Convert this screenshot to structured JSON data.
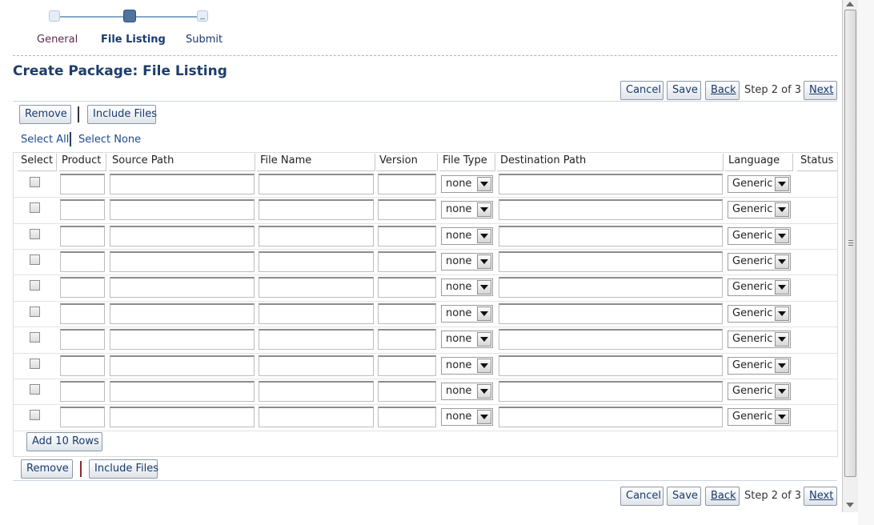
{
  "train": {
    "steps": [
      {
        "label": "General",
        "state": "visited"
      },
      {
        "label": "File Listing",
        "state": "current"
      },
      {
        "label": "Submit",
        "state": "unvisited"
      }
    ]
  },
  "page": {
    "title": "Create Package: File Listing"
  },
  "nav": {
    "cancel": "Cancel",
    "save": "Save",
    "back": "Back",
    "step_text": "Step 2 of 3",
    "next": "Next"
  },
  "actions": {
    "remove": "Remove",
    "include_files": "Include Files",
    "select_all": "Select All",
    "select_none": "Select None",
    "add_rows": "Add 10 Rows"
  },
  "table": {
    "columns": [
      "Select",
      "Product",
      "Source Path",
      "File Name",
      "Version",
      "File Type",
      "Destination Path",
      "Language",
      "Status"
    ],
    "rows": [
      {
        "product": "",
        "source_path": "",
        "file_name": "",
        "version": "",
        "file_type": "none",
        "destination_path": "",
        "language": "Generic",
        "status": ""
      },
      {
        "product": "",
        "source_path": "",
        "file_name": "",
        "version": "",
        "file_type": "none",
        "destination_path": "",
        "language": "Generic",
        "status": ""
      },
      {
        "product": "",
        "source_path": "",
        "file_name": "",
        "version": "",
        "file_type": "none",
        "destination_path": "",
        "language": "Generic",
        "status": ""
      },
      {
        "product": "",
        "source_path": "",
        "file_name": "",
        "version": "",
        "file_type": "none",
        "destination_path": "",
        "language": "Generic",
        "status": ""
      },
      {
        "product": "",
        "source_path": "",
        "file_name": "",
        "version": "",
        "file_type": "none",
        "destination_path": "",
        "language": "Generic",
        "status": ""
      },
      {
        "product": "",
        "source_path": "",
        "file_name": "",
        "version": "",
        "file_type": "none",
        "destination_path": "",
        "language": "Generic",
        "status": ""
      },
      {
        "product": "",
        "source_path": "",
        "file_name": "",
        "version": "",
        "file_type": "none",
        "destination_path": "",
        "language": "Generic",
        "status": ""
      },
      {
        "product": "",
        "source_path": "",
        "file_name": "",
        "version": "",
        "file_type": "none",
        "destination_path": "",
        "language": "Generic",
        "status": ""
      },
      {
        "product": "",
        "source_path": "",
        "file_name": "",
        "version": "",
        "file_type": "none",
        "destination_path": "",
        "language": "Generic",
        "status": ""
      },
      {
        "product": "",
        "source_path": "",
        "file_name": "",
        "version": "",
        "file_type": "none",
        "destination_path": "",
        "language": "Generic",
        "status": ""
      }
    ]
  },
  "icons": {
    "dropdown": "chevron-down-icon",
    "scroll_up": "arrow-up-icon",
    "scroll_down": "arrow-down-icon"
  },
  "colors": {
    "title": "#1e3d6c",
    "link": "#1e4a8a",
    "train_current": "#4f739c",
    "train_visited_label": "#5d2c4e"
  }
}
